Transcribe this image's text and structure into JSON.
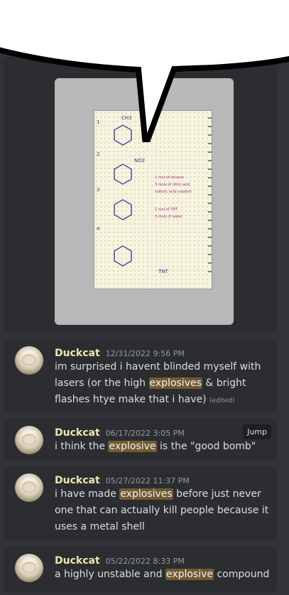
{
  "messages": [
    {
      "author": "Duckcat",
      "timestamp": "12/31/2022 9:56 PM",
      "text_before": "im surprised i havent blinded myself with lasers (or the high ",
      "highlight": "explosives",
      "text_after": " & bright flashes htye make that i have)",
      "edited": "(edited)"
    },
    {
      "author": "Duckcat",
      "timestamp": "06/17/2022 3:05 PM",
      "text_before": "i think the ",
      "highlight": "explosive",
      "text_after": " is the \"good bomb\"",
      "jump_label": "Jump"
    },
    {
      "author": "Duckcat",
      "timestamp": "05/27/2022 11:37 PM",
      "text_before": "i have made ",
      "highlight": "explosives",
      "text_after": " before just never one that can actually kill people because it uses a metal shell"
    },
    {
      "author": "Duckcat",
      "timestamp": "05/22/2022 8:33 PM",
      "text_before": "a highly unstable and ",
      "highlight": "explosive",
      "text_after": " compound"
    }
  ],
  "notebook": {
    "steps": [
      "1",
      "2",
      "3",
      "4"
    ],
    "formula_labels": [
      "CH3",
      "NO2",
      "TNT"
    ],
    "notes": [
      "1 mol of toluene",
      "3 mols of nitric acid",
      "sulfuric acid catalyst",
      "1 mol of TNT",
      "3 mols of water"
    ]
  },
  "colors": {
    "background": "#313338",
    "card": "#2b2d31",
    "author": "#f0e6b2",
    "highlight": "rgba(240,178,50,0.35)"
  }
}
